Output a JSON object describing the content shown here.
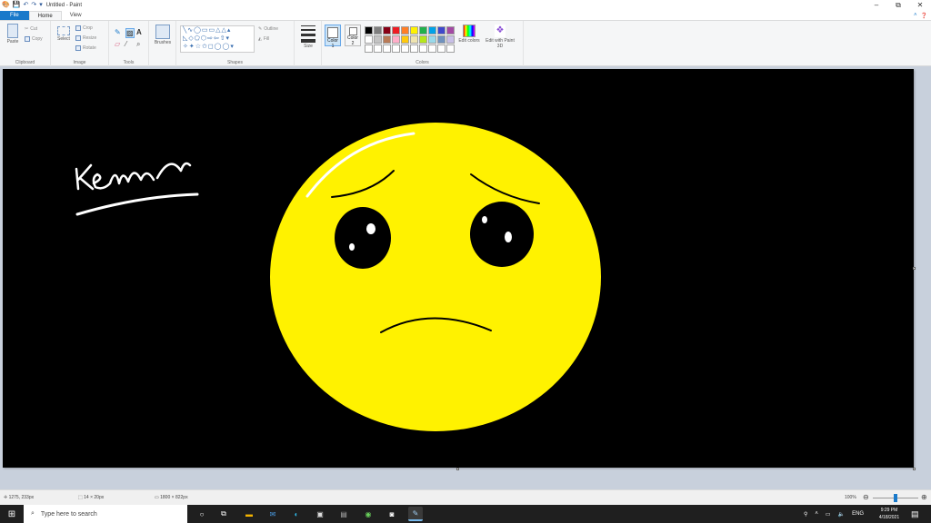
{
  "window": {
    "title": "Untitled - Paint",
    "minimize": "–",
    "maximize": "⧉",
    "close": "✕"
  },
  "tabs": [
    {
      "label": "File"
    },
    {
      "label": "Home"
    },
    {
      "label": "View"
    }
  ],
  "ribbon": {
    "clipboard": {
      "paste": "Paste",
      "cut": "Cut",
      "copy": "Copy",
      "label": "Clipboard"
    },
    "image": {
      "select": "Select",
      "crop": "Crop",
      "resize": "Resize",
      "rotate": "Rotate",
      "label": "Image"
    },
    "tools": {
      "label": "Tools"
    },
    "brushes": {
      "label": "Brushes"
    },
    "shapes": {
      "outline": "Outline",
      "fill": "Fill",
      "label": "Shapes"
    },
    "size": {
      "label": "Size"
    },
    "colors": {
      "color1": "Color 1",
      "color2": "Color 2",
      "edit_colors": "Edit colors",
      "edit_paint3d": "Edit with Paint 3D",
      "label": "Colors",
      "color1_value": "#ffffff",
      "color2_value": "#ffffff",
      "palette": [
        "#000000",
        "#7f7f7f",
        "#880015",
        "#ed1c24",
        "#ff7f27",
        "#fff200",
        "#22b14c",
        "#00a2e8",
        "#3f48cc",
        "#a349a4",
        "#ffffff",
        "#c3c3c3",
        "#b97a57",
        "#ffaec9",
        "#ffc90e",
        "#efe4b0",
        "#b5e61d",
        "#99d9ea",
        "#7092be",
        "#c8bfe7",
        "#ffffff",
        "#ffffff",
        "#ffffff",
        "#ffffff",
        "#ffffff",
        "#ffffff",
        "#ffffff",
        "#ffffff",
        "#ffffff",
        "#ffffff"
      ]
    }
  },
  "canvas": {
    "background": "#000000",
    "face_color": "#fff200",
    "signature": "Kerr"
  },
  "status": {
    "cursor_pos": "1275, 233px",
    "selection_size": "14 × 20px",
    "image_size": "1800 × 822px",
    "zoom": "100%"
  },
  "taskbar": {
    "search_placeholder": "Type here to search",
    "language": "ENG",
    "time": "9:29 PM",
    "date": "4/18/2021"
  }
}
